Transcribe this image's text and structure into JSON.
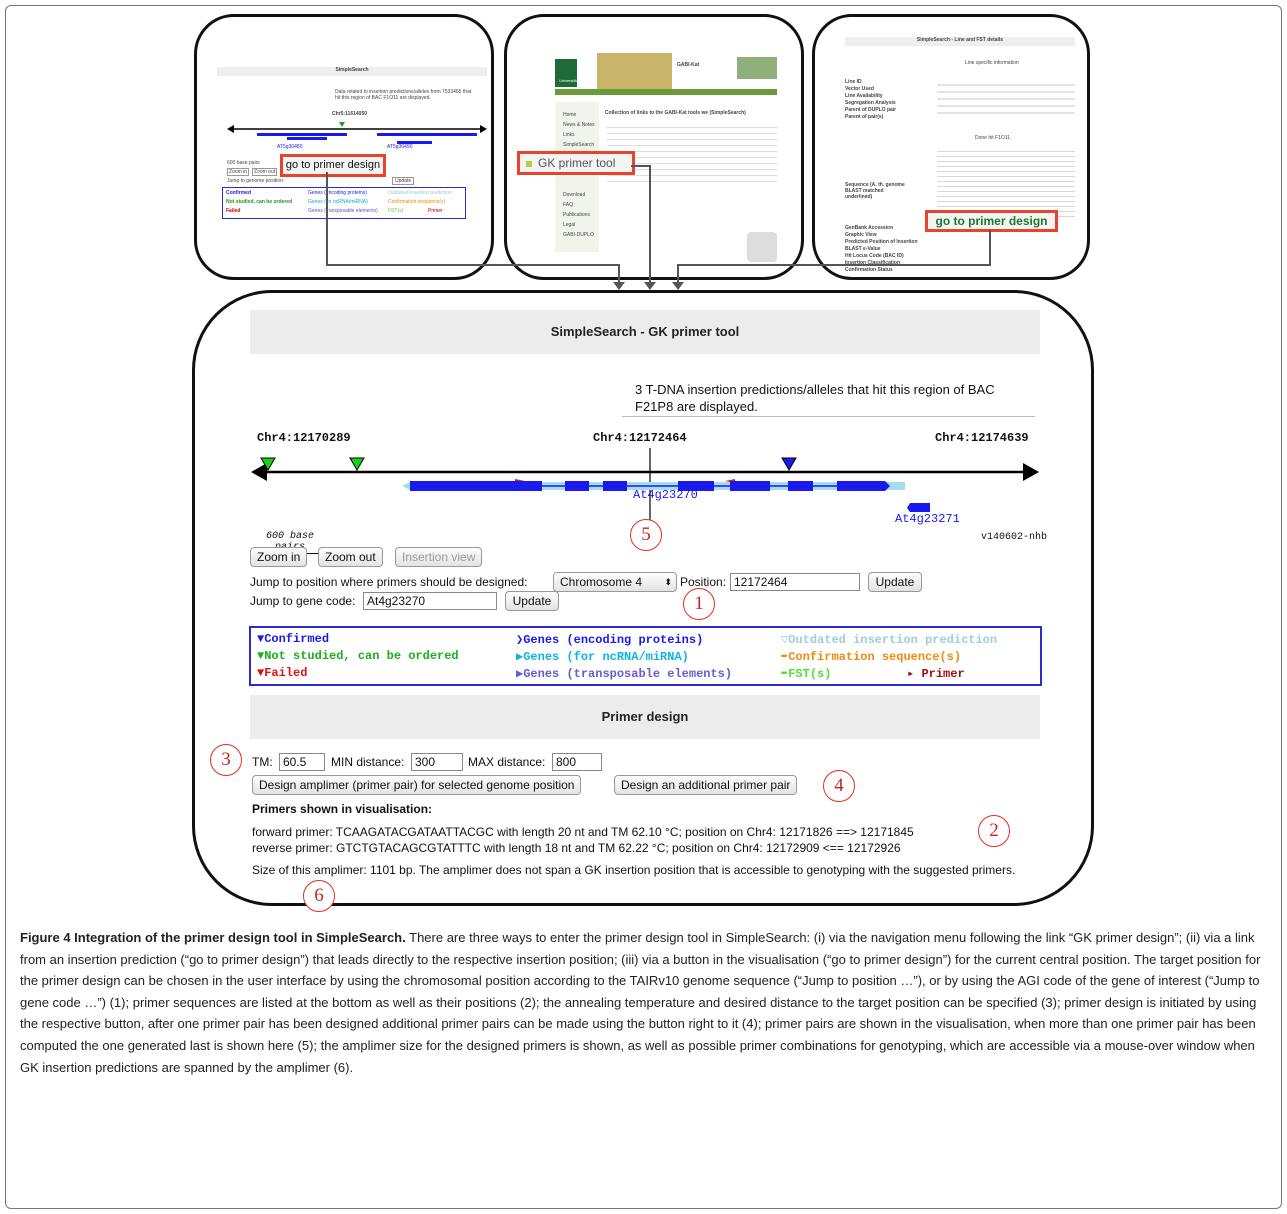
{
  "thumb1": {
    "title": "SimpleSearch",
    "info": "Data related to insertion predictions/alleles from 7533465 that hit this region of BAC F1O11 are displayed.",
    "position": "Chr5:11614050",
    "gene_a": "AT5g30480",
    "gene_b": "AT5g30490",
    "scale": "600 base pairs",
    "btn_zoom_in": "Zoom in",
    "btn_zoom_out": "Zoom out",
    "jump_label": "Jump to genome position:",
    "update": "Update",
    "callout": "go to primer design",
    "legend": [
      "Confirmed",
      "Not studied, can be ordered",
      "Failed",
      "Genes (encoding proteins)",
      "Genes (for ncRNA/miRNA)",
      "Genes (transposable elements)",
      "Outdated insertion prediction",
      "Confirmation sequence(s)",
      "FST(s)",
      "Primer"
    ]
  },
  "thumb2": {
    "header": "GABI-Kat",
    "institution": "Universität Bielefeld",
    "callout": "GK primer tool",
    "collection_title": "Collection of links to the GABI-Kat tools we (SimpleSearch)",
    "menu": [
      "Home",
      "News & Notes",
      "Links",
      "SimpleSearch",
      "GK primer tool",
      "Download",
      "FAQ",
      "Publications",
      "Legal",
      "GABI-DUPLO"
    ]
  },
  "thumb3": {
    "title": "SimpleSearch - Line and FST details",
    "subtitle": "Line specific information",
    "fields": [
      "Line ID",
      "Vector Used",
      "Line Availability",
      "Segregation Analysis",
      "Parent of DUPLO pair",
      "Parent of pair(s)"
    ],
    "done": "Done hit F1O11",
    "seq_label": "Sequence (A. th. genome BLAST matched underlined)",
    "fields2": [
      "GenBank Accession",
      "Graphic View",
      "Predicted Position of Insertion",
      "BLAST e-Value",
      "Hit Locus Code (BAC ID)",
      "Insertion Classification",
      "Confirmation Status"
    ],
    "callout": "go to primer design"
  },
  "main": {
    "title": "SimpleSearch - GK primer tool",
    "info": "3 T-DNA insertion predictions/alleles that hit this region of BAC F21P8 are displayed.",
    "pos_left": "Chr4:12170289",
    "pos_center": "Chr4:12172464",
    "pos_right": "Chr4:12174639",
    "gene1": "At4g23270",
    "gene2": "At4g23271",
    "scale": "600 base pairs",
    "version": "v140602-nhb",
    "btn_zoom_in": "Zoom in",
    "btn_zoom_out": "Zoom out",
    "btn_insertion_view": "Insertion view",
    "jump_pos_label": "Jump to position where primers should be designed:",
    "chromosome": "Chromosome 4",
    "position_label": "Position:",
    "position_value": "12172464",
    "update": "Update",
    "jump_gene_label": "Jump to gene code:",
    "gene_value": "At4g23270",
    "legend": {
      "confirmed": "Confirmed",
      "not_studied": "Not studied, can be ordered",
      "failed": "Failed",
      "genes_protein": "Genes (encoding proteins)",
      "genes_ncrna": "Genes (for ncRNA/miRNA)",
      "genes_te": "Genes (transposable elements)",
      "outdated": "Outdated insertion prediction",
      "confirmation": "Confirmation sequence(s)",
      "fst": "FST(s)",
      "primer": "Primer"
    },
    "primer_design_title": "Primer design",
    "tm_label": "TM:",
    "tm_value": "60.5",
    "min_label": "MIN distance:",
    "min_value": "300",
    "max_label": "MAX distance:",
    "max_value": "800",
    "btn_design": "Design amplimer (primer pair) for selected genome position",
    "btn_additional": "Design an additional primer pair",
    "primers_heading": "Primers shown in visualisation:",
    "forward": "forward primer: TCAAGATACGATAATTACGC with length 20 nt and TM 62.10 °C; position on Chr4: 12171826 ==> 12171845",
    "reverse": "reverse primer: GTCTGTACAGCGTATTTC with length 18 nt and TM 62.22 °C; position on Chr4: 12172909 <== 12172926",
    "size": "Size of this amplimer: 1101 bp. The amplimer does not span a GK insertion position that is accessible to genotyping with the suggested primers."
  },
  "callouts": [
    "1",
    "2",
    "3",
    "4",
    "5",
    "6"
  ],
  "caption": {
    "title": "Figure 4 Integration of the primer design tool in SimpleSearch.",
    "text": "There are three ways to enter the primer design tool in SimpleSearch: (i) via the navigation menu following the link “GK primer design”; (ii) via a link from an insertion prediction (“go to primer design”) that leads directly to the respective insertion position; (iii) via a button in the visualisation (“go to primer design”) for the current central position. The target position for the primer design can be chosen in the user interface by using the chromosomal position according to the TAIRv10 genome sequence (“Jump to position …”), or by using the AGI code of the gene of interest (“Jump to gene code …”) (1); primer sequences are listed at the bottom as well as their positions (2); the annealing temperature and desired distance to the target position can be specified (3); primer design is initiated by using the respective button, after one primer pair has been designed additional primer pairs can be made using the button right to it (4); primer pairs are shown in the visualisation, when more than one primer pair has been computed the one generated last is shown here (5); the amplimer size for the designed primers is shown, as well as possible primer combinations for genotyping, which are accessible via a mouse-over window when GK insertion predictions are spanned by the amplimer (6)."
  },
  "colors": {
    "callout_red": "#e8432d",
    "legend_blue": "#2b2bd0",
    "gene_blue": "#1a1aee",
    "utr": "#a6dcf0"
  }
}
